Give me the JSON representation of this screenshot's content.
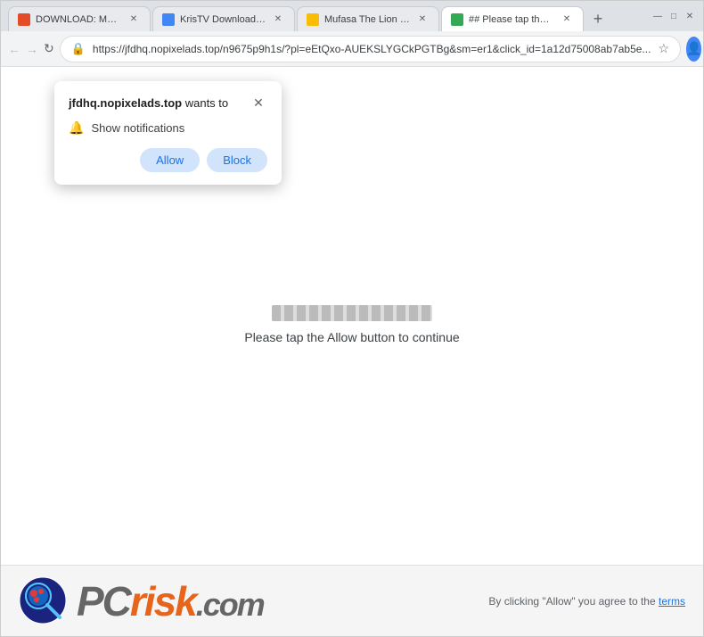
{
  "browser": {
    "tabs": [
      {
        "id": 1,
        "label": "DOWNLOAD: Mufasa...",
        "active": false,
        "favicon_color": "#e34c26"
      },
      {
        "id": 2,
        "label": "KrisTV Download Pa...",
        "active": false,
        "favicon_color": "#4285f4"
      },
      {
        "id": 3,
        "label": "Mufasa The Lion Kin...",
        "active": false,
        "favicon_color": "#fbbc04"
      },
      {
        "id": 4,
        "label": "## Please tap the All...",
        "active": true,
        "favicon_color": "#34a853"
      }
    ],
    "new_tab_label": "+",
    "url": "https://jfdhq.nopixelads.top/n9675p9h1s/?pl=eEtQxo-AUEKSLYGCkPGTBg&sm=er1&click_id=1a12d75008ab7ab5e...",
    "window_controls": {
      "minimize": "—",
      "maximize": "□",
      "close": "✕"
    }
  },
  "popup": {
    "title_domain": "jfdhq.nopixelads.top",
    "title_suffix": " wants to",
    "close_icon": "✕",
    "notification_icon": "🔔",
    "notification_text": "Show notifications",
    "allow_label": "Allow",
    "block_label": "Block"
  },
  "page": {
    "loading_text": "Please tap the Allow button to continue"
  },
  "branding": {
    "logo_pc": "PC",
    "logo_risk": "risk",
    "logo_com": ".com",
    "terms_text": "By clicking \"Allow\" you agree to the",
    "terms_link": "terms"
  },
  "nav": {
    "back_icon": "←",
    "forward_icon": "→",
    "refresh_icon": "↻",
    "lock_icon": "🔒",
    "star_icon": "☆",
    "profile_icon": "👤",
    "menu_icon": "⋮"
  }
}
